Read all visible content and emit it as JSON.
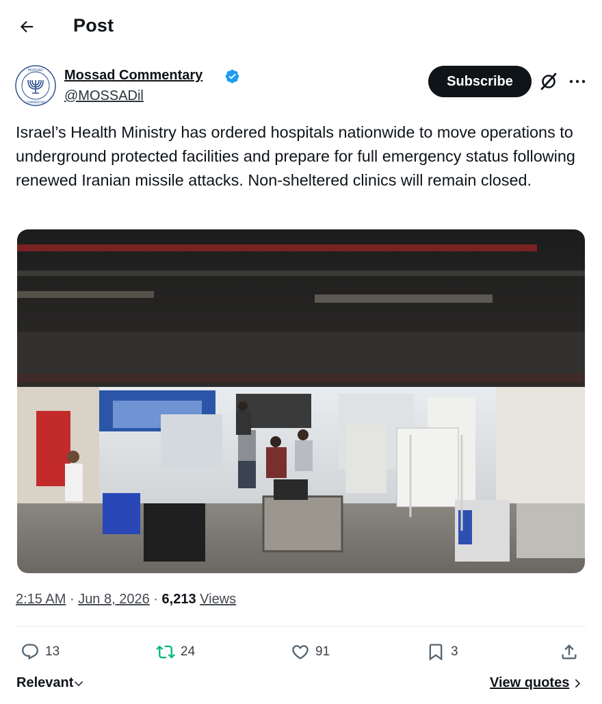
{
  "header": {
    "title": "Post"
  },
  "author": {
    "display_name": "Mossad Commentary",
    "handle": "@MOSSADil",
    "verified": true,
    "avatar_icon": "menorah-seal-icon",
    "avatar_text": "MOSSAD COMMENTARY"
  },
  "actions": {
    "subscribe_label": "Subscribe"
  },
  "post": {
    "text": "Israel’s Health Ministry has ordered hospitals nationwide to move operations to underground protected facilities and prepare for full emergency status following renewed Iranian missile attacks. Non-sheltered clinics will remain closed.",
    "media_description_icon": "photo-underground-hospital"
  },
  "meta": {
    "time": "2:15 AM",
    "separator": "·",
    "date": "Jun 8, 2026",
    "views_count": "6,213",
    "views_label": "Views"
  },
  "engagement": {
    "replies": "13",
    "reposts": "24",
    "likes": "91",
    "bookmarks": "3"
  },
  "footer": {
    "sort_label": "Relevant",
    "view_quotes_label": "View quotes"
  },
  "colors": {
    "accent_dark": "#0f1419",
    "verified_blue": "#1d9bf0",
    "repost_green": "#00ba7c",
    "icon_gray": "#536471"
  }
}
